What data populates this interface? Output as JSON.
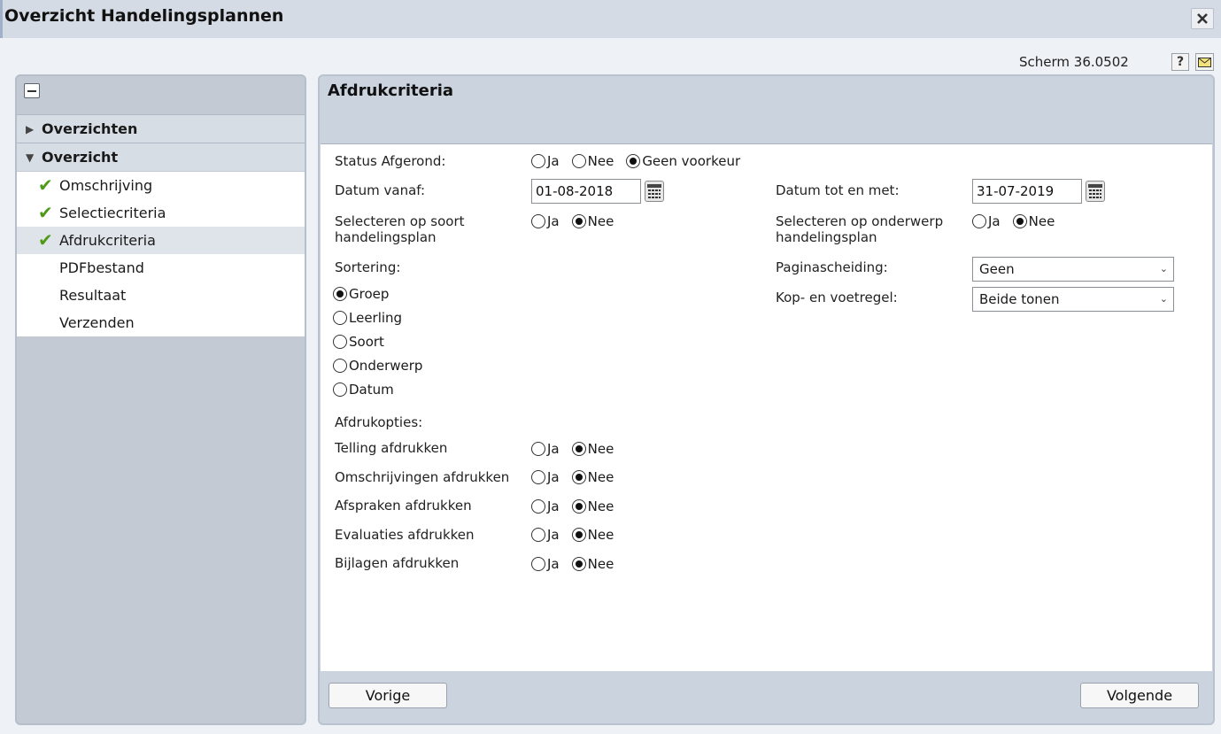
{
  "window": {
    "title": "Overzicht Handelingsplannen",
    "screen_code": "Scherm 36.0502",
    "help_label": "?"
  },
  "sidebar": {
    "sections": [
      {
        "label": "Overzichten",
        "expanded": false
      },
      {
        "label": "Overzicht",
        "expanded": true
      }
    ],
    "items": [
      {
        "label": "Omschrijving",
        "done": true
      },
      {
        "label": "Selectiecriteria",
        "done": true
      },
      {
        "label": "Afdrukcriteria",
        "done": true,
        "active": true
      },
      {
        "label": "PDFbestand",
        "done": false
      },
      {
        "label": "Resultaat",
        "done": false
      },
      {
        "label": "Verzenden",
        "done": false
      }
    ]
  },
  "main": {
    "title": "Afdrukcriteria",
    "options": {
      "ja": "Ja",
      "nee": "Nee",
      "geen_voorkeur": "Geen voorkeur"
    },
    "status_afgerond": {
      "label": "Status Afgerond:",
      "value": "Geen voorkeur"
    },
    "datum_vanaf": {
      "label": "Datum vanaf:",
      "value": "01-08-2018"
    },
    "datum_tot": {
      "label": "Datum tot en met:",
      "value": "31-07-2019"
    },
    "soort": {
      "label_line1": "Selecteren op soort",
      "label_line2": "handelingsplan",
      "value": "Nee"
    },
    "onderwerp": {
      "label_line1": "Selecteren op onderwerp",
      "label_line2": "handelingsplan",
      "value": "Nee"
    },
    "sortering": {
      "label": "Sortering:",
      "options": [
        "Groep",
        "Leerling",
        "Soort",
        "Onderwerp",
        "Datum"
      ],
      "selected": "Groep"
    },
    "paginascheiding": {
      "label": "Paginascheiding:",
      "value": "Geen"
    },
    "kopvoet": {
      "label": "Kop- en voetregel:",
      "value": "Beide tonen"
    },
    "afdrukopties": {
      "label": "Afdrukopties:",
      "rows": [
        {
          "label": "Telling afdrukken",
          "value": "Nee"
        },
        {
          "label": "Omschrijvingen afdrukken",
          "value": "Nee"
        },
        {
          "label": "Afspraken afdrukken",
          "value": "Nee"
        },
        {
          "label": "Evaluaties afdrukken",
          "value": "Nee"
        },
        {
          "label": "Bijlagen afdrukken",
          "value": "Nee"
        }
      ]
    }
  },
  "footer": {
    "prev_label": "Vorige",
    "next_label": "Volgende"
  },
  "colors": {
    "check": "#4e9a16",
    "panel": "#cbd3de",
    "sidebar": "#c3cad4"
  }
}
